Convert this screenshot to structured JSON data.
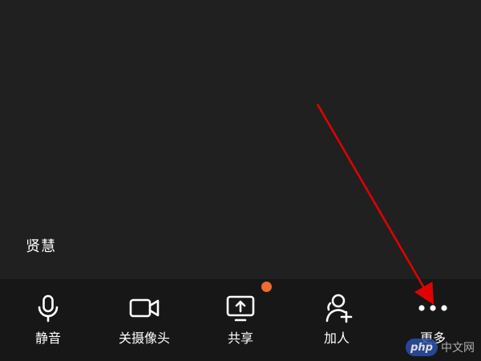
{
  "participant": {
    "name": "贤慧"
  },
  "toolbar": {
    "items": [
      {
        "id": "mute",
        "label": "静音",
        "icon": "microphone-icon"
      },
      {
        "id": "camera",
        "label": "关摄像头",
        "icon": "video-camera-icon"
      },
      {
        "id": "share",
        "label": "共享",
        "icon": "screen-share-icon",
        "badge": true
      },
      {
        "id": "invite",
        "label": "加人",
        "icon": "add-person-icon"
      },
      {
        "id": "more",
        "label": "更多",
        "icon": "more-dots-icon"
      }
    ]
  },
  "colors": {
    "background": "#202020",
    "toolbar_background": "#171717",
    "badge": "#f26a2e",
    "annotation_arrow": "#e00000"
  },
  "watermark": {
    "logo_text": "php",
    "text": "中文网"
  }
}
